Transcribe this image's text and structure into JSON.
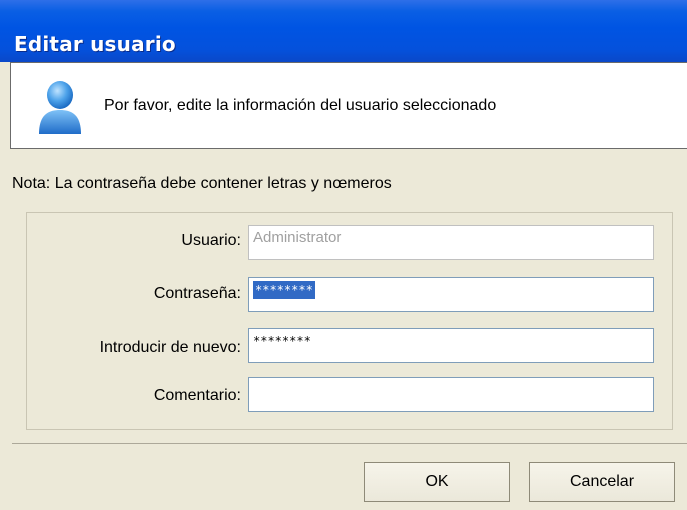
{
  "window": {
    "title": "Editar usuario"
  },
  "header": {
    "message": "Por favor, edite la información del usuario seleccionado",
    "icon": "user-icon"
  },
  "note": "Nota: La contraseña debe contener letras y nœmeros",
  "form": {
    "usuario": {
      "label": "Usuario:",
      "value": "Administrator",
      "enabled": false
    },
    "contrasena": {
      "label": "Contraseña:",
      "value": "********",
      "selected": true
    },
    "reintroducir": {
      "label": "Introducir de nuevo:",
      "value": "********"
    },
    "comentario": {
      "label": "Comentario:",
      "value": ""
    }
  },
  "buttons": {
    "ok": "OK",
    "cancel": "Cancelar"
  },
  "colors": {
    "titlebar": "#0054e3",
    "dialog_bg": "#ece9d8",
    "selection": "#316ac5"
  }
}
